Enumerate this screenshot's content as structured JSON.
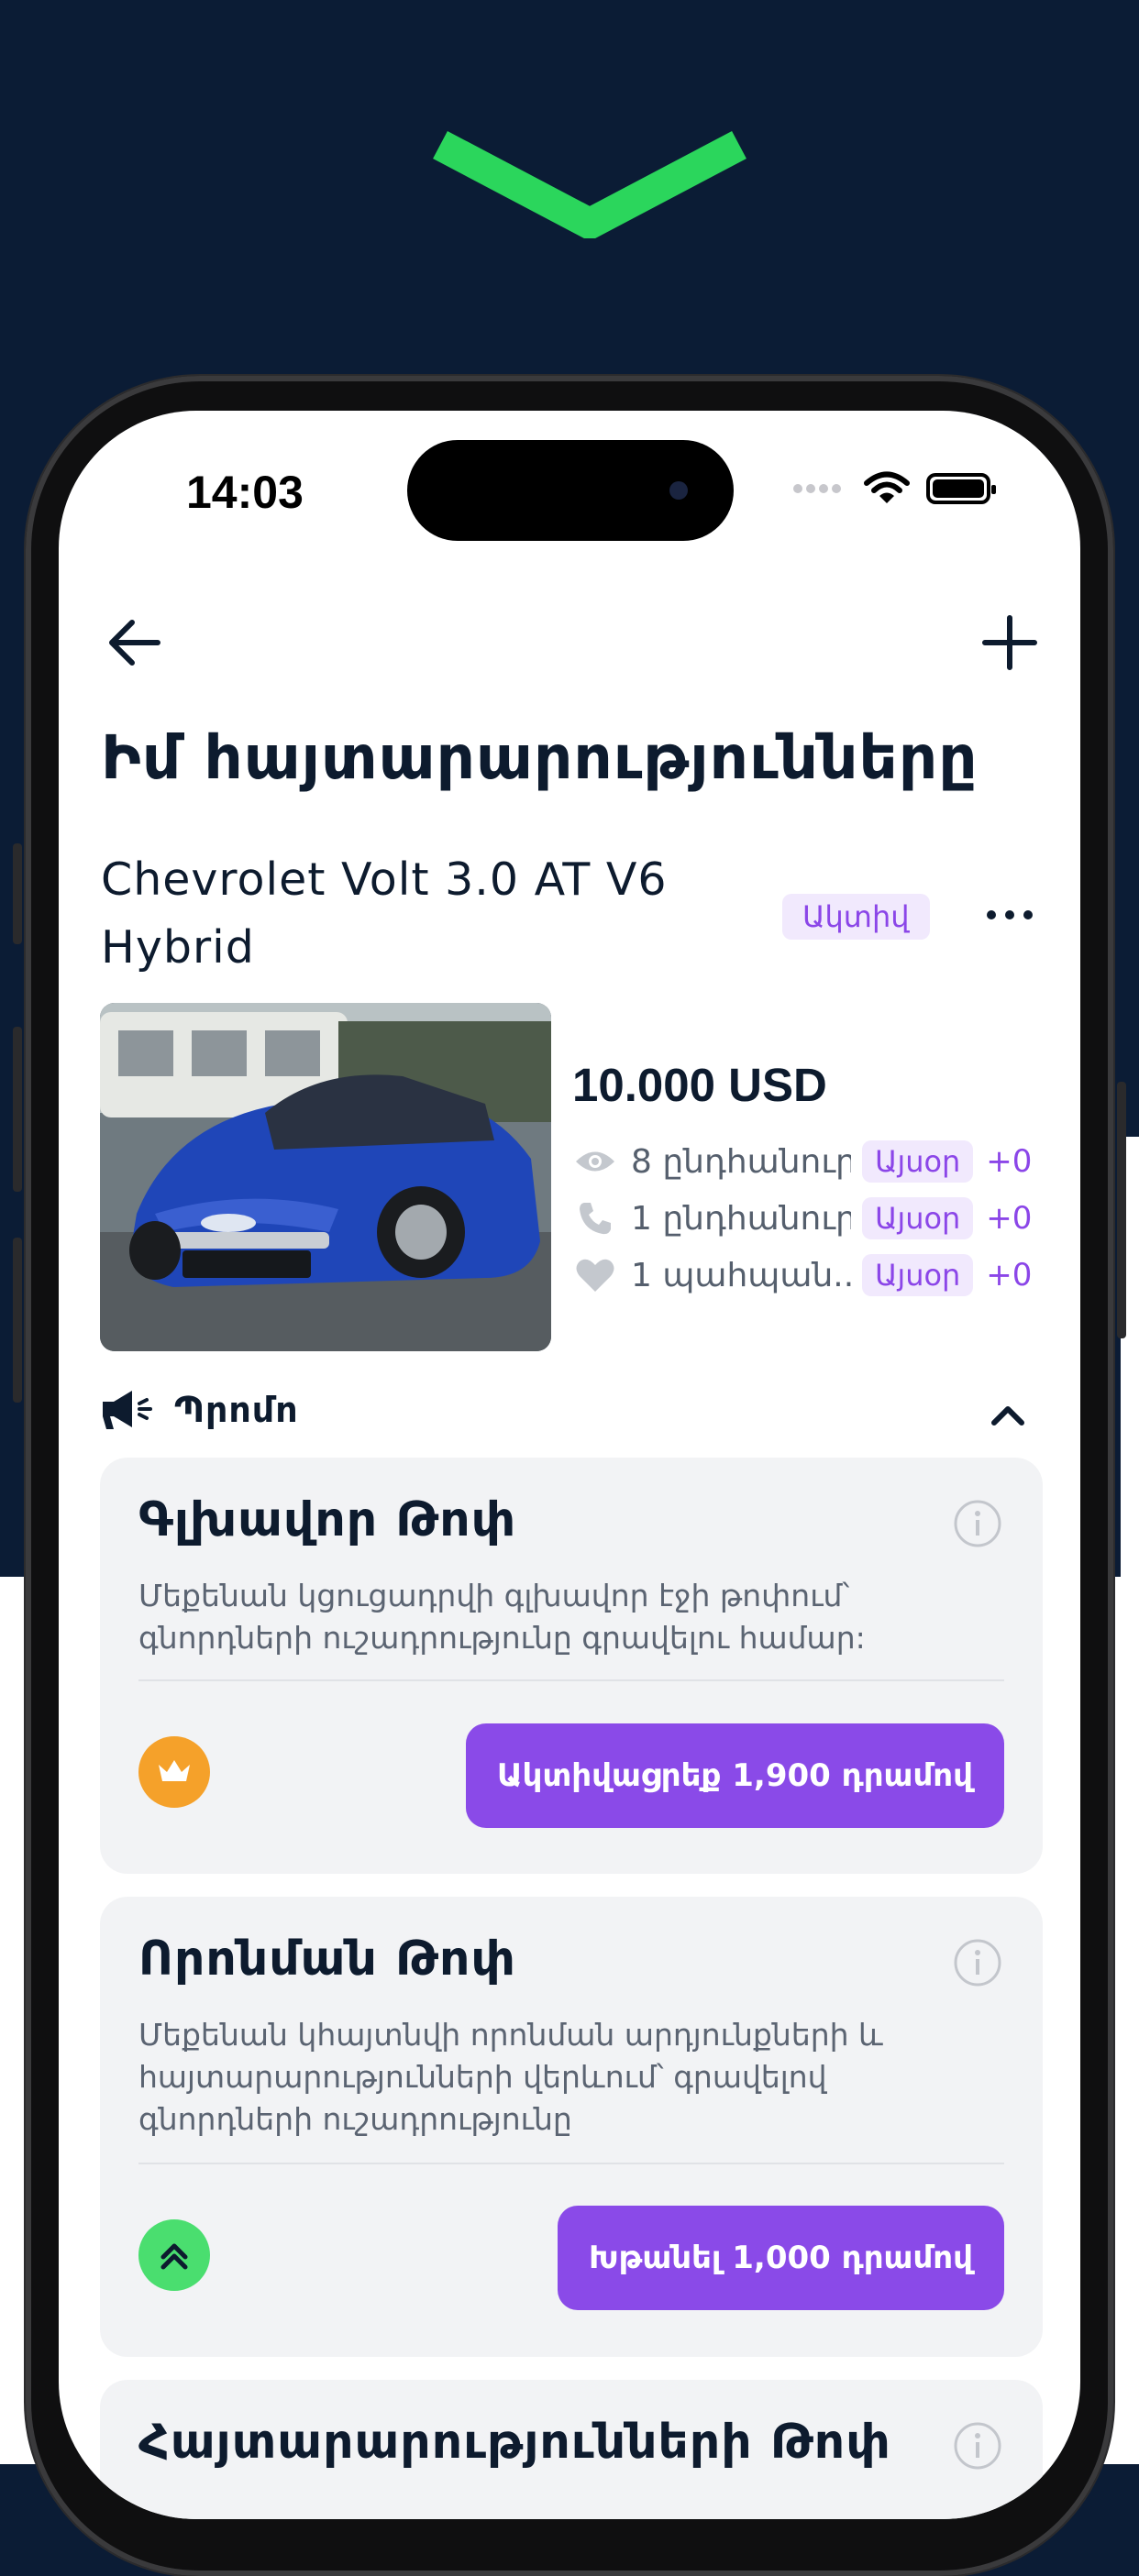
{
  "status_bar": {
    "time": "14:03"
  },
  "nav": {
    "back_icon": "arrow-left-icon",
    "add_icon": "plus-icon"
  },
  "page": {
    "title": "Իմ հայտարարությունները"
  },
  "listing": {
    "name": "Chevrolet Volt 3.0 AT V6 Hybrid",
    "status": "Ակտիվ",
    "price": "10.000 USD",
    "stats": [
      {
        "icon": "eye-icon",
        "label": "8 ընդհանուր",
        "today": "Այսօր",
        "delta": "+0"
      },
      {
        "icon": "phone-icon",
        "label": "1 ընդհանուր",
        "today": "Այսօր",
        "delta": "+0"
      },
      {
        "icon": "heart-icon",
        "label": "1 պահպան...",
        "today": "Այսօր",
        "delta": "+0"
      }
    ]
  },
  "promo": {
    "label": "Պրոմո",
    "cards": [
      {
        "title": "Գլխավոր Թոփ",
        "description": "Մեքենան կցուցադրվի գլխավոր էջի թոփում՝ գնորդների ուշադրությունը գրավելու համար:",
        "button": "Ակտիվացրեք 1,900 դրամով",
        "icon": "crown-icon",
        "icon_color": "#f5a12a"
      },
      {
        "title": "Որոնման Թոփ",
        "description": "Մեքենան կհայտնվի որոնման արդյունքների և հայտարարությունների վերևում՝ գրավելով գնորդների ուշադրությունը",
        "button": "Խթանել 1,000 դրամով",
        "icon": "double-chevron-up-icon",
        "icon_color": "#4ade6f"
      },
      {
        "title": "Հայտարարությունների Թոփ"
      }
    ]
  },
  "colors": {
    "accent": "#8a4ae8",
    "background": "#0b1c35",
    "chevron": "#2bd65c"
  }
}
